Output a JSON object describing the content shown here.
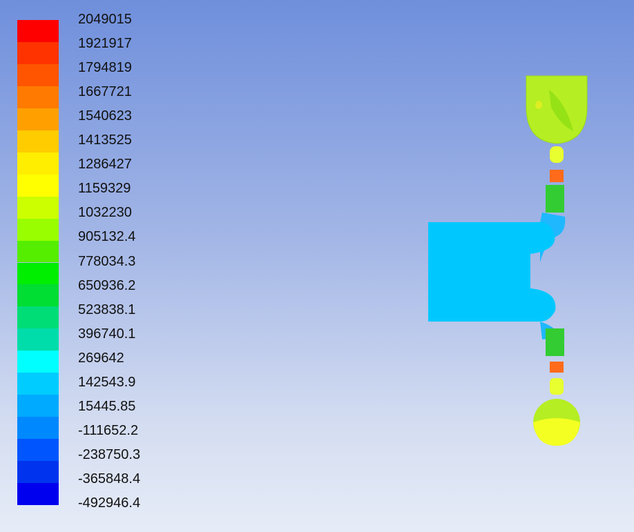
{
  "legend": {
    "colors": [
      "#ff0000",
      "#ff3300",
      "#ff5500",
      "#ff7a00",
      "#ffa000",
      "#ffcc00",
      "#ffee00",
      "#ffff00",
      "#ccff00",
      "#99ff00",
      "#55ee00",
      "#00ee00",
      "#00dd33",
      "#00dd77",
      "#00ddaa",
      "#00ffff",
      "#00ccff",
      "#00aaff",
      "#0088ff",
      "#0055ff",
      "#0033ee",
      "#0000ee"
    ],
    "labels": [
      "2049015",
      "1921917",
      "1794819",
      "1667721",
      "1540623",
      "1413525",
      "1286427",
      "1159329",
      "1032230",
      "905132.4",
      "778034.3",
      "650936.2",
      "523838.1",
      "396740.1",
      "269642",
      "142543.9",
      "15445.85",
      "-111652.2",
      "-238750.3",
      "-365848.4",
      "-492946.4"
    ]
  }
}
